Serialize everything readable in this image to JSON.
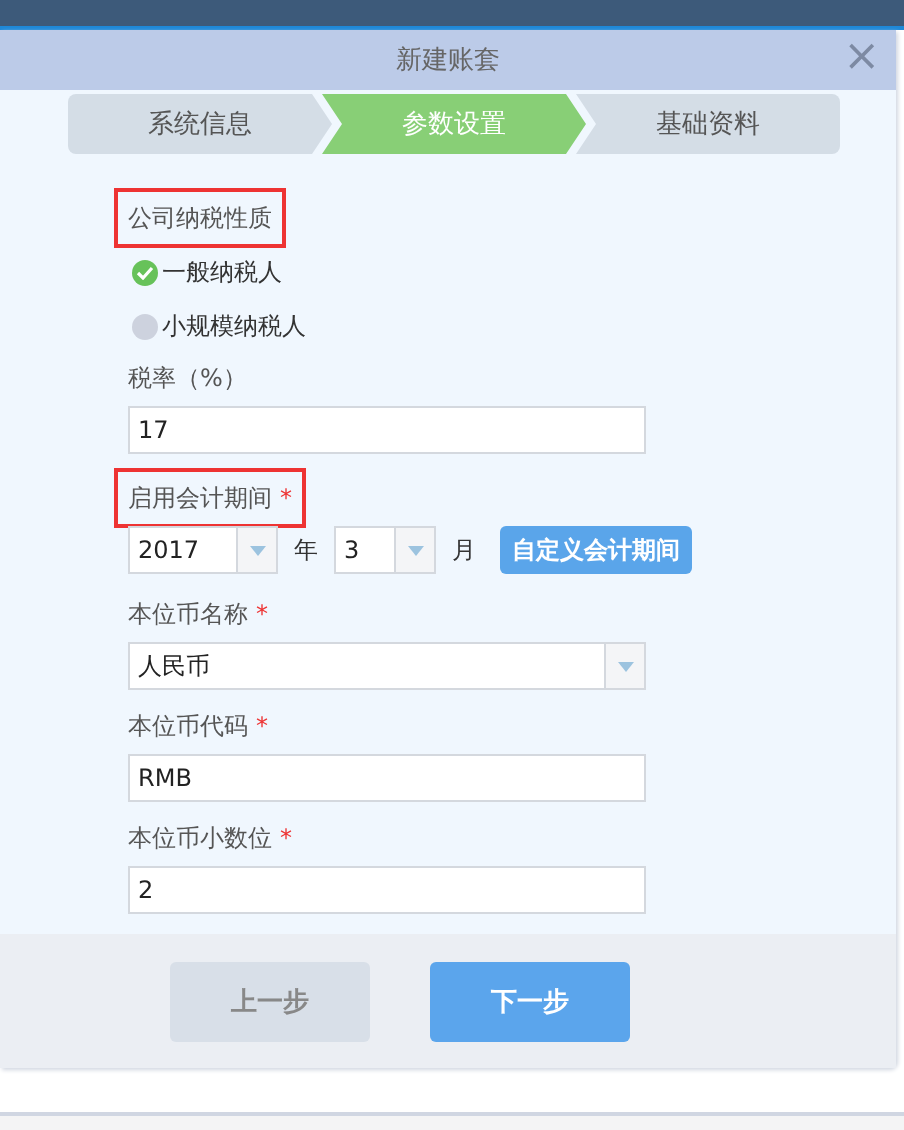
{
  "dialog": {
    "title": "新建账套",
    "close": "×"
  },
  "steps": [
    {
      "label": "系统信息",
      "selected": false
    },
    {
      "label": "参数设置",
      "selected": true
    },
    {
      "label": "基础资料",
      "selected": false
    }
  ],
  "tax_type": {
    "label": "公司纳税性质",
    "highlighted": true,
    "options": [
      {
        "label": "一般纳税人",
        "selected": true
      },
      {
        "label": "小规模纳税人",
        "selected": false
      }
    ]
  },
  "tax_rate": {
    "label": "税率（%）",
    "value": "17"
  },
  "period": {
    "label": "启用会计期间",
    "required_mark": "*",
    "highlighted": true,
    "year": "2017",
    "year_unit": "年",
    "month": "3",
    "month_unit": "月",
    "custom_button": "自定义会计期间"
  },
  "currency_fields": [
    {
      "kind": "select",
      "label": "本位币名称",
      "required_mark": "*",
      "value": "人民币"
    },
    {
      "kind": "input",
      "label": "本位币代码",
      "required_mark": "*",
      "value": "RMB"
    },
    {
      "kind": "input",
      "label": "本位币小数位",
      "required_mark": "*",
      "value": "2"
    }
  ],
  "buttons": [
    {
      "label": "上一步",
      "primary": false
    },
    {
      "label": "下一步",
      "primary": true
    }
  ]
}
